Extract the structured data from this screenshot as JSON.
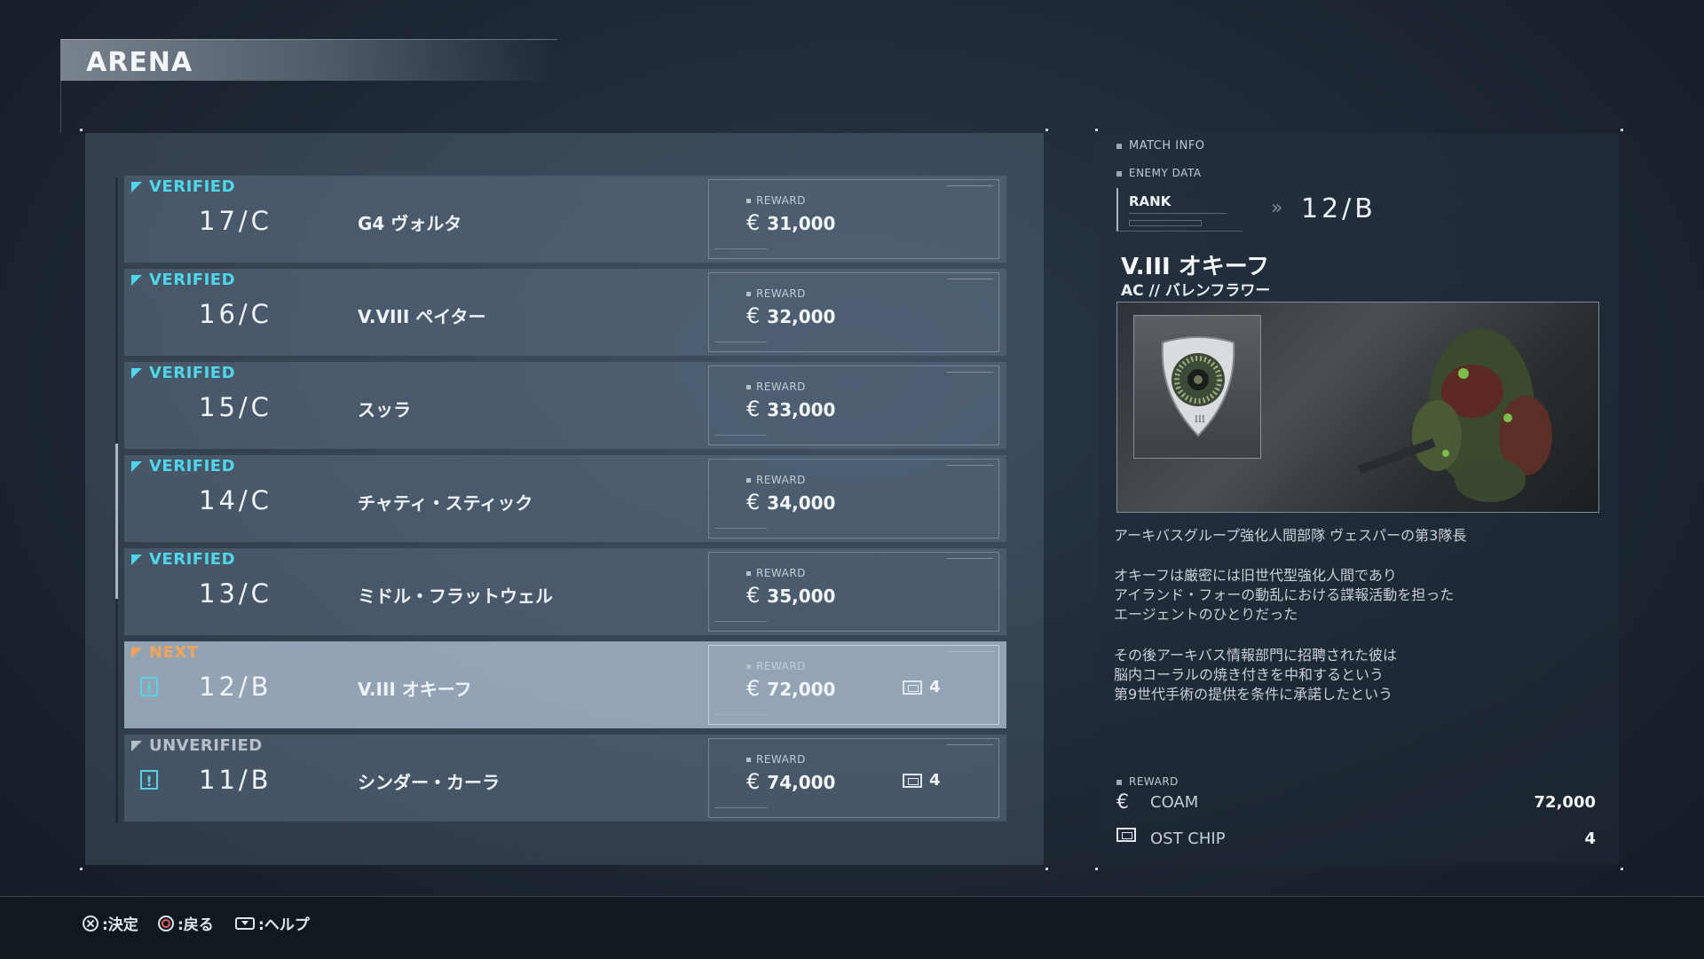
{
  "screen_title": "ARENA",
  "matches": [
    {
      "status": "VERIFIED",
      "state": "verified",
      "rank": "17/C",
      "name": "G4 ヴォルタ",
      "reward_label": "REWARD",
      "reward": "31,000",
      "chip": null
    },
    {
      "status": "VERIFIED",
      "state": "verified",
      "rank": "16/C",
      "name": "V.VIII ペイター",
      "reward_label": "REWARD",
      "reward": "32,000",
      "chip": null
    },
    {
      "status": "VERIFIED",
      "state": "verified",
      "rank": "15/C",
      "name": "スッラ",
      "reward_label": "REWARD",
      "reward": "33,000",
      "chip": null
    },
    {
      "status": "VERIFIED",
      "state": "verified",
      "rank": "14/C",
      "name": "チャティ・スティック",
      "reward_label": "REWARD",
      "reward": "34,000",
      "chip": null
    },
    {
      "status": "VERIFIED",
      "state": "verified",
      "rank": "13/C",
      "name": "ミドル・フラットウェル",
      "reward_label": "REWARD",
      "reward": "35,000",
      "chip": null
    },
    {
      "status": "NEXT",
      "state": "next",
      "rank": "12/B",
      "name": "V.III オキーフ",
      "reward_label": "REWARD",
      "reward": "72,000",
      "chip": "4"
    },
    {
      "status": "UNVERIFIED",
      "state": "unverified",
      "rank": "11/B",
      "name": "シンダー・カーラ",
      "reward_label": "REWARD",
      "reward": "74,000",
      "chip": "4"
    }
  ],
  "currency_symbol": "€",
  "match_info": {
    "section_label": "MATCH INFO",
    "enemy_data_label": "ENEMY DATA",
    "rank_label": "RANK",
    "rank_value": "12/B",
    "enemy_name": "V.III オキーフ",
    "ac_name": "AC // バレンフラワー",
    "description_1": "アーキバスグループ強化人間部隊 ヴェスパーの第3隊長",
    "description_2": "オキーフは厳密には旧世代型強化人間であり\nアイランド・フォーの動乱における諜報活動を担った\nエージェントのひとりだった",
    "description_3": "その後アーキバス情報部門に招聘された彼は\n脳内コーラルの焼き付きを中和するという\n第9世代手術の提供を条件に承諾したという",
    "reward_label": "REWARD",
    "coam_label": "COAM",
    "coam_value": "72,000",
    "ost_label": "OST CHIP",
    "ost_value": "4"
  },
  "hints": {
    "confirm": ":決定",
    "back": ":戻る",
    "help": ":ヘルプ"
  },
  "colors": {
    "verified": "#4fd6ea",
    "next": "#f2a45a",
    "unverified": "#b5c0cb"
  },
  "icons": [
    "flag-icon",
    "alert-icon",
    "currency-icon",
    "ost-chip-icon",
    "cross-button-icon",
    "circle-button-icon",
    "touchpad-button-icon"
  ]
}
